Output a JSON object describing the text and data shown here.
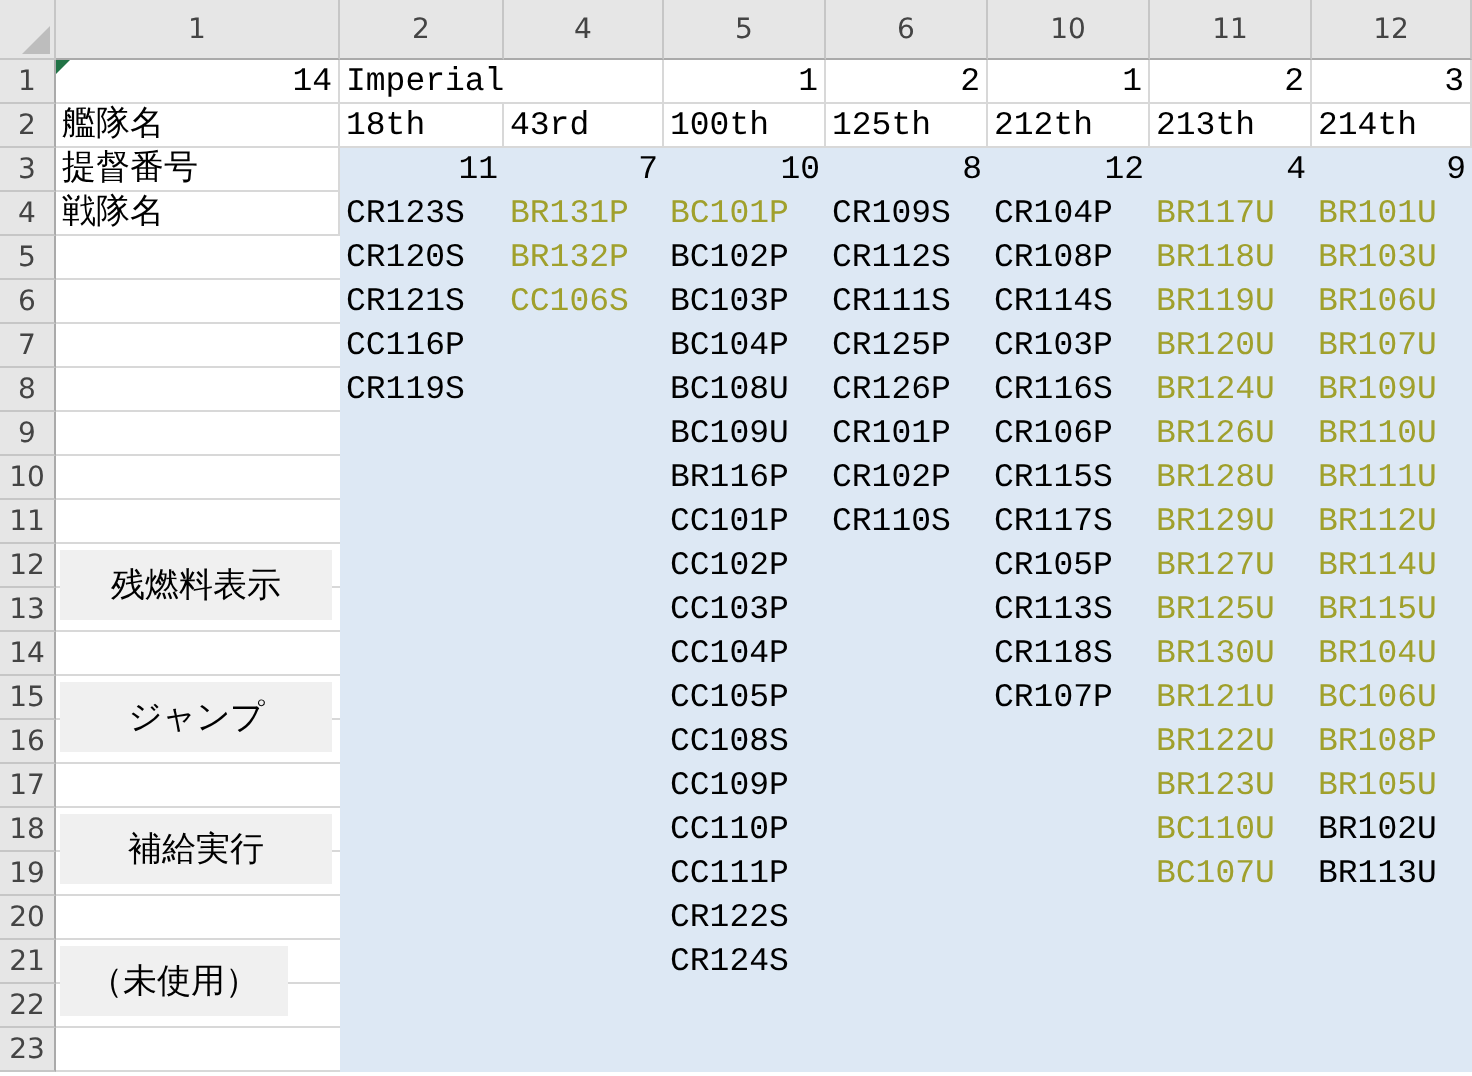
{
  "column_headers": [
    "1",
    "2",
    "4",
    "5",
    "6",
    "10",
    "11",
    "12"
  ],
  "row_headers": [
    "1",
    "2",
    "3",
    "4",
    "5",
    "6",
    "7",
    "8",
    "9",
    "10",
    "11",
    "12",
    "13",
    "14",
    "15",
    "16",
    "17",
    "18",
    "19",
    "20",
    "21",
    "22",
    "23"
  ],
  "label_column": {
    "total": "14",
    "labels": [
      "艦隊名",
      "提督番号",
      "戦隊名"
    ]
  },
  "buttons": [
    {
      "label": "残燃料表示"
    },
    {
      "label": "ジャンプ"
    },
    {
      "label": "補給実行"
    },
    {
      "label": "（未使用）"
    }
  ],
  "fleets": [
    {
      "top": {
        "kind": "text",
        "value": "Imperial"
      },
      "name": "18th",
      "count": "11",
      "units": [
        {
          "code": "CR123S",
          "color": "#000000"
        },
        {
          "code": "CR120S",
          "color": "#000000"
        },
        {
          "code": "CR121S",
          "color": "#000000"
        },
        {
          "code": "CC116P",
          "color": "#000000"
        },
        {
          "code": "CR119S",
          "color": "#000000"
        }
      ]
    },
    {
      "name": "43rd",
      "count": "7",
      "units": [
        {
          "code": "BR131P",
          "color": "#a0a02c"
        },
        {
          "code": "BR132P",
          "color": "#a0a02c"
        },
        {
          "code": "CC106S",
          "color": "#a0a02c"
        }
      ]
    },
    {
      "top": {
        "kind": "number",
        "value": "1"
      },
      "name": "100th",
      "count": "10",
      "units": [
        {
          "code": "BC101P",
          "color": "#a0a02c"
        },
        {
          "code": "BC102P",
          "color": "#000000"
        },
        {
          "code": "BC103P",
          "color": "#000000"
        },
        {
          "code": "BC104P",
          "color": "#000000"
        },
        {
          "code": "BC108U",
          "color": "#000000"
        },
        {
          "code": "BC109U",
          "color": "#000000"
        },
        {
          "code": "BR116P",
          "color": "#000000"
        },
        {
          "code": "CC101P",
          "color": "#000000"
        },
        {
          "code": "CC102P",
          "color": "#000000"
        },
        {
          "code": "CC103P",
          "color": "#000000"
        },
        {
          "code": "CC104P",
          "color": "#000000"
        },
        {
          "code": "CC105P",
          "color": "#000000"
        },
        {
          "code": "CC108S",
          "color": "#000000"
        },
        {
          "code": "CC109P",
          "color": "#000000"
        },
        {
          "code": "CC110P",
          "color": "#000000"
        },
        {
          "code": "CC111P",
          "color": "#000000"
        },
        {
          "code": "CR122S",
          "color": "#000000"
        },
        {
          "code": "CR124S",
          "color": "#000000"
        }
      ]
    },
    {
      "top": {
        "kind": "number",
        "value": "2"
      },
      "name": "125th",
      "count": "8",
      "units": [
        {
          "code": "CR109S",
          "color": "#000000"
        },
        {
          "code": "CR112S",
          "color": "#000000"
        },
        {
          "code": "CR111S",
          "color": "#000000"
        },
        {
          "code": "CR125P",
          "color": "#000000"
        },
        {
          "code": "CR126P",
          "color": "#000000"
        },
        {
          "code": "CR101P",
          "color": "#000000"
        },
        {
          "code": "CR102P",
          "color": "#000000"
        },
        {
          "code": "CR110S",
          "color": "#000000"
        }
      ]
    },
    {
      "top": {
        "kind": "number",
        "value": "1"
      },
      "name": "212th",
      "count": "12",
      "units": [
        {
          "code": "CR104P",
          "color": "#000000"
        },
        {
          "code": "CR108P",
          "color": "#000000"
        },
        {
          "code": "CR114S",
          "color": "#000000"
        },
        {
          "code": "CR103P",
          "color": "#000000"
        },
        {
          "code": "CR116S",
          "color": "#000000"
        },
        {
          "code": "CR106P",
          "color": "#000000"
        },
        {
          "code": "CR115S",
          "color": "#000000"
        },
        {
          "code": "CR117S",
          "color": "#000000"
        },
        {
          "code": "CR105P",
          "color": "#000000"
        },
        {
          "code": "CR113S",
          "color": "#000000"
        },
        {
          "code": "CR118S",
          "color": "#000000"
        },
        {
          "code": "CR107P",
          "color": "#000000"
        }
      ]
    },
    {
      "top": {
        "kind": "number",
        "value": "2"
      },
      "name": "213th",
      "count": "4",
      "units": [
        {
          "code": "BR117U",
          "color": "#a0a02c"
        },
        {
          "code": "BR118U",
          "color": "#a0a02c"
        },
        {
          "code": "BR119U",
          "color": "#a0a02c"
        },
        {
          "code": "BR120U",
          "color": "#a0a02c"
        },
        {
          "code": "BR124U",
          "color": "#a0a02c"
        },
        {
          "code": "BR126U",
          "color": "#a0a02c"
        },
        {
          "code": "BR128U",
          "color": "#a0a02c"
        },
        {
          "code": "BR129U",
          "color": "#a0a02c"
        },
        {
          "code": "BR127U",
          "color": "#a0a02c"
        },
        {
          "code": "BR125U",
          "color": "#a0a02c"
        },
        {
          "code": "BR130U",
          "color": "#a0a02c"
        },
        {
          "code": "BR121U",
          "color": "#a0a02c"
        },
        {
          "code": "BR122U",
          "color": "#a0a02c"
        },
        {
          "code": "BR123U",
          "color": "#a0a02c"
        },
        {
          "code": "BC110U",
          "color": "#a0a02c"
        },
        {
          "code": "BC107U",
          "color": "#a0a02c"
        }
      ]
    },
    {
      "top": {
        "kind": "number",
        "value": "3"
      },
      "name": "214th",
      "count": "9",
      "units": [
        {
          "code": "BR101U",
          "color": "#a0a02c"
        },
        {
          "code": "BR103U",
          "color": "#a0a02c"
        },
        {
          "code": "BR106U",
          "color": "#a0a02c"
        },
        {
          "code": "BR107U",
          "color": "#a0a02c"
        },
        {
          "code": "BR109U",
          "color": "#a0a02c"
        },
        {
          "code": "BR110U",
          "color": "#a0a02c"
        },
        {
          "code": "BR111U",
          "color": "#a0a02c"
        },
        {
          "code": "BR112U",
          "color": "#a0a02c"
        },
        {
          "code": "BR114U",
          "color": "#a0a02c"
        },
        {
          "code": "BR115U",
          "color": "#a0a02c"
        },
        {
          "code": "BR104U",
          "color": "#a0a02c"
        },
        {
          "code": "BC106U",
          "color": "#a0a02c"
        },
        {
          "code": "BR108P",
          "color": "#a0a02c"
        },
        {
          "code": "BR105U",
          "color": "#a0a02c"
        },
        {
          "code": "BR102U",
          "color": "#000000"
        },
        {
          "code": "BR113U",
          "color": "#000000"
        }
      ]
    }
  ]
}
